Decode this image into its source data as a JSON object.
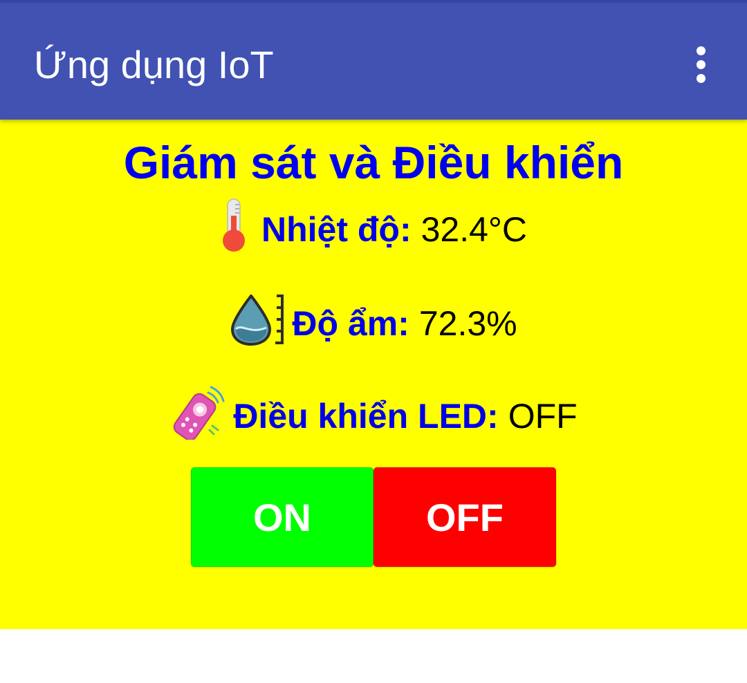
{
  "app_bar": {
    "title": "Ứng dụng IoT",
    "menu_icon": "more-vert-icon",
    "background": "#4152b3"
  },
  "main": {
    "background": "#ffff00",
    "heading": "Giám sát và Điều khiển",
    "temperature": {
      "icon": "thermometer-icon",
      "label": "Nhiệt độ:",
      "value": "32.4°C"
    },
    "humidity": {
      "icon": "water-drop-icon",
      "label": "Độ ẩm:",
      "value": "72.3%"
    },
    "led": {
      "icon": "remote-control-icon",
      "label": "Điều khiển LED:",
      "value": "OFF"
    },
    "buttons": {
      "on": {
        "label": "ON",
        "color": "#00ff00"
      },
      "off": {
        "label": "OFF",
        "color": "#ff0000"
      }
    }
  }
}
